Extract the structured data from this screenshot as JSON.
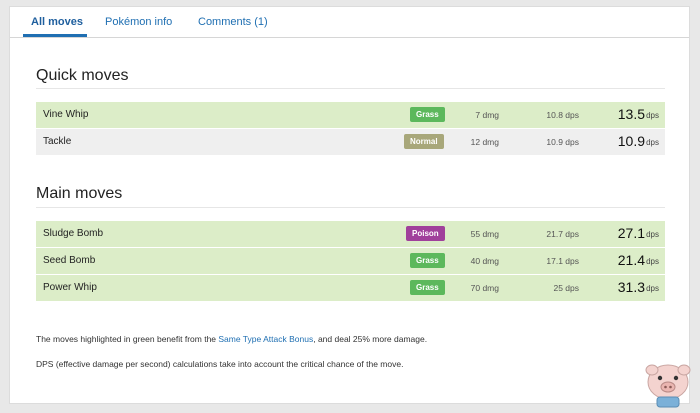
{
  "tabs": [
    {
      "label": "All moves"
    },
    {
      "label": "Pokémon info"
    },
    {
      "label": "Comments (1)"
    }
  ],
  "quick": {
    "title": "Quick moves",
    "moves": [
      {
        "name": "Vine Whip",
        "type": "Grass",
        "type_color": "#5cb85c",
        "dmg": "7 dmg",
        "dps_small": "10.8 dps",
        "dps_big": "13.5",
        "unit": "dps",
        "stab": true
      },
      {
        "name": "Tackle",
        "type": "Normal",
        "type_color": "#a8a77a",
        "dmg": "12 dmg",
        "dps_small": "10.9 dps",
        "dps_big": "10.9",
        "unit": "dps",
        "stab": false
      }
    ]
  },
  "main": {
    "title": "Main moves",
    "moves": [
      {
        "name": "Sludge Bomb",
        "type": "Poison",
        "type_color": "#a0409b",
        "dmg": "55 dmg",
        "dps_small": "21.7 dps",
        "dps_big": "27.1",
        "unit": "dps",
        "stab": true
      },
      {
        "name": "Seed Bomb",
        "type": "Grass",
        "type_color": "#5cb85c",
        "dmg": "40 dmg",
        "dps_small": "17.1 dps",
        "dps_big": "21.4",
        "unit": "dps",
        "stab": true
      },
      {
        "name": "Power Whip",
        "type": "Grass",
        "type_color": "#5cb85c",
        "dmg": "70 dmg",
        "dps_small": "25 dps",
        "dps_big": "31.3",
        "unit": "dps",
        "stab": true
      }
    ]
  },
  "notes": {
    "stab_before": "The moves highlighted in green benefit from the ",
    "stab_link": "Same Type Attack Bonus",
    "stab_after": ", and deal 25% more damage.",
    "dps_note": "DPS (effective damage per second) calculations take into account the critical chance of the move."
  },
  "colors": {
    "accent": "#1f6fb2",
    "stab_row": "#dcedc8",
    "plain_row": "#efefef"
  },
  "watermark_icon": "pig-mascot-icon"
}
